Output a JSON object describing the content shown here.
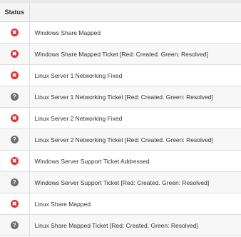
{
  "table": {
    "header": {
      "status": "Status",
      "name": ""
    },
    "rows": [
      {
        "status": "failed",
        "icon": "x-circle-icon",
        "name": "Windows Share Mapped"
      },
      {
        "status": "failed",
        "icon": "x-circle-icon",
        "name": "Windows Share Mapped Ticket [Red: Created. Green: Resolved]"
      },
      {
        "status": "failed",
        "icon": "x-circle-icon",
        "name": "Linux Server 1 Networking Fixed"
      },
      {
        "status": "unknown",
        "icon": "question-circle-icon",
        "name": "Linux Server 1 Networking Ticket [Red: Created. Green: Resolved]"
      },
      {
        "status": "failed",
        "icon": "x-circle-icon",
        "name": "Linux Server 2 Networking Fixed"
      },
      {
        "status": "unknown",
        "icon": "question-circle-icon",
        "name": "Linux Server 2 Networking Ticket [Red: Created. Green: Resolved]"
      },
      {
        "status": "failed",
        "icon": "x-circle-icon",
        "name": "Windows Server Support Ticket Addressed"
      },
      {
        "status": "unknown",
        "icon": "question-circle-icon",
        "name": "Windows Server Support Ticket [Red: Created. Green: Resolved]"
      },
      {
        "status": "failed",
        "icon": "x-circle-icon",
        "name": "Linux Share Mapped"
      },
      {
        "status": "unknown",
        "icon": "question-circle-icon",
        "name": "Linux Share Mapped Ticket [Red: Created. Green: Resolved]"
      }
    ],
    "glyphs": {
      "failed": "✖",
      "unknown": "?"
    },
    "colors": {
      "failed": "#e0312f",
      "unknown": "#6e6e6e"
    }
  }
}
